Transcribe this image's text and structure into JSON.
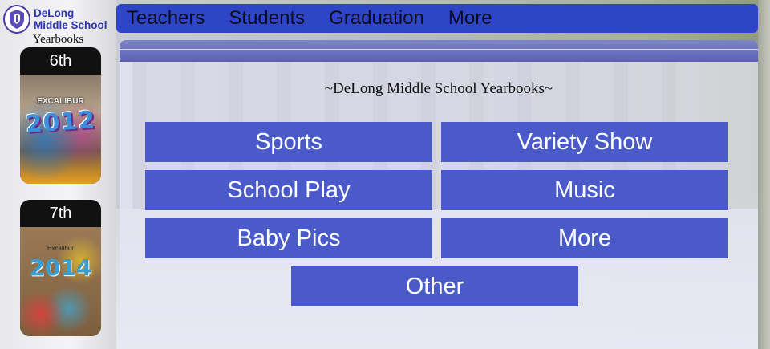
{
  "logo": {
    "line1": "DeLong",
    "line2": "Middle School",
    "emblem_icon": "knights-crest-icon"
  },
  "sidebar": {
    "title": "Yearbooks",
    "books": [
      {
        "label": "6th",
        "cover_title": "EXCALIBUR",
        "cover_year": "2012"
      },
      {
        "label": "7th",
        "cover_title": "Excalibur",
        "cover_year": "2014"
      }
    ]
  },
  "nav": {
    "items": [
      "Teachers",
      "Students",
      "Graduation",
      "More"
    ]
  },
  "main": {
    "heading": "~DeLong Middle School Yearbooks~",
    "buttons": [
      "Sports",
      "Variety Show",
      "School Play",
      "Music",
      "Baby Pics",
      "More",
      "Other"
    ]
  },
  "colors": {
    "nav_bg": "#2f45c8",
    "button_bg": "#4a5bc9",
    "logo_text": "#2b35b5"
  }
}
